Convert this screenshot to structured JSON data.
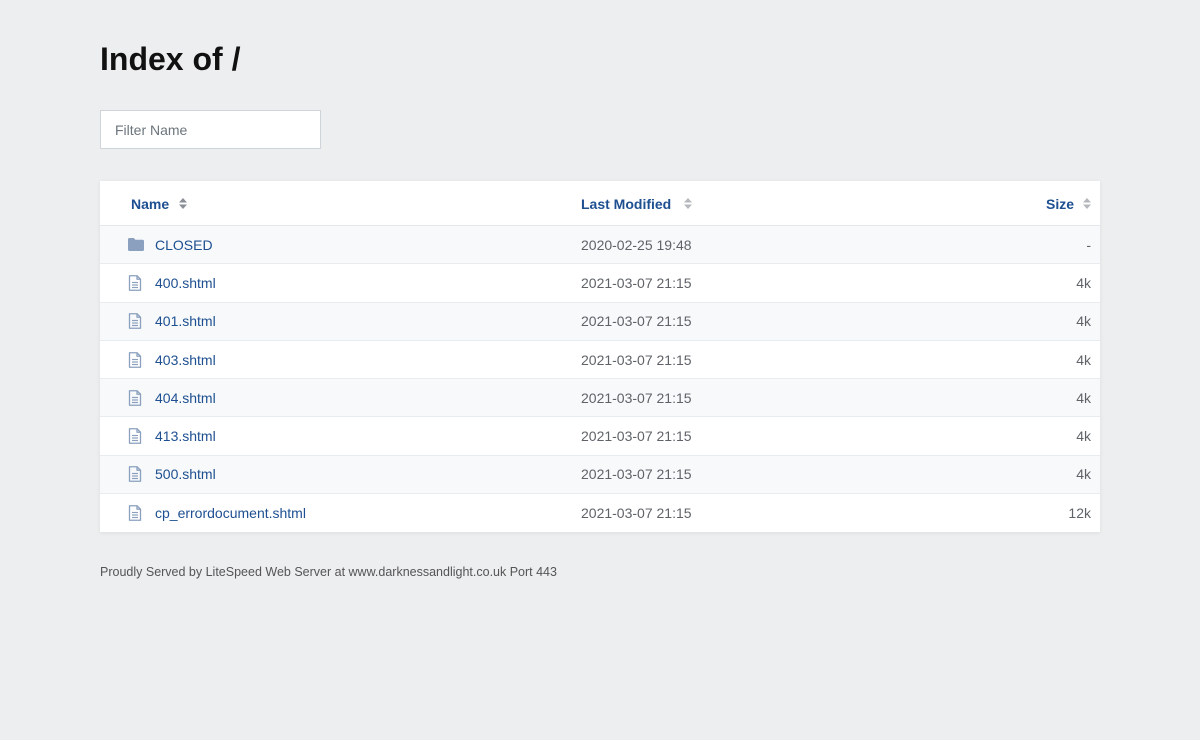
{
  "page": {
    "title": "Index of /",
    "filter_placeholder": "Filter Name"
  },
  "table": {
    "headers": {
      "name": "Name",
      "modified": "Last Modified",
      "size": "Size"
    },
    "rows": [
      {
        "type": "folder",
        "icon": "folder-icon",
        "name": "CLOSED",
        "modified": "2020-02-25 19:48",
        "size": "-"
      },
      {
        "type": "file",
        "icon": "file-icon",
        "name": "400.shtml",
        "modified": "2021-03-07 21:15",
        "size": "4k"
      },
      {
        "type": "file",
        "icon": "file-icon",
        "name": "401.shtml",
        "modified": "2021-03-07 21:15",
        "size": "4k"
      },
      {
        "type": "file",
        "icon": "file-icon",
        "name": "403.shtml",
        "modified": "2021-03-07 21:15",
        "size": "4k"
      },
      {
        "type": "file",
        "icon": "file-icon",
        "name": "404.shtml",
        "modified": "2021-03-07 21:15",
        "size": "4k"
      },
      {
        "type": "file",
        "icon": "file-icon",
        "name": "413.shtml",
        "modified": "2021-03-07 21:15",
        "size": "4k"
      },
      {
        "type": "file",
        "icon": "file-icon",
        "name": "500.shtml",
        "modified": "2021-03-07 21:15",
        "size": "4k"
      },
      {
        "type": "file",
        "icon": "file-icon",
        "name": "cp_errordocument.shtml",
        "modified": "2021-03-07 21:15",
        "size": "12k"
      }
    ]
  },
  "footer": {
    "text": "Proudly Served by LiteSpeed Web Server at www.darknessandlight.co.uk Port 443"
  },
  "colors": {
    "background": "#eceeef",
    "link": "#1d4f91",
    "icon": "#8aa0be"
  }
}
